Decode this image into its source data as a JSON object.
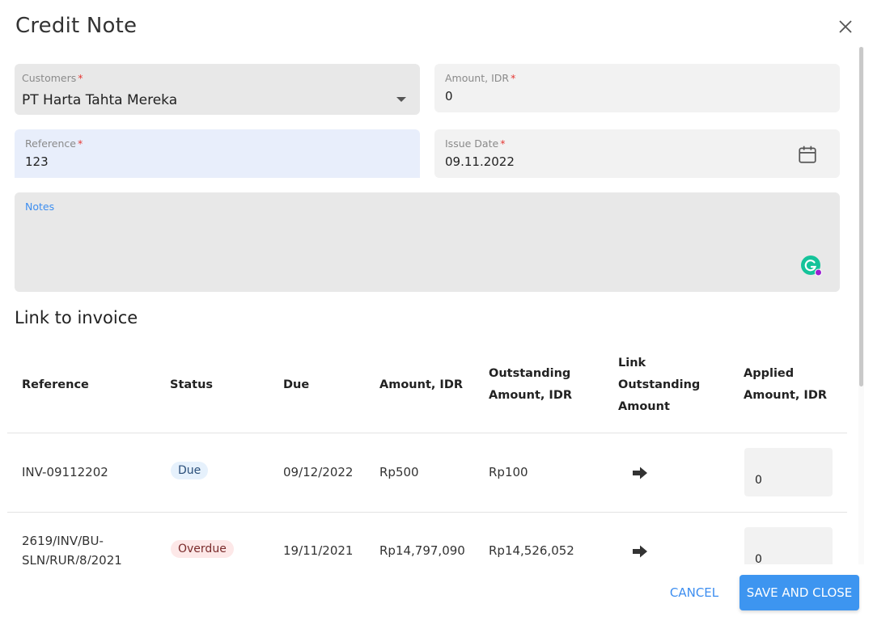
{
  "dialog": {
    "title": "Credit Note"
  },
  "form": {
    "customers": {
      "label": "Customers",
      "required_mark": "*",
      "value": "PT Harta Tahta Mereka"
    },
    "amount": {
      "label": "Amount, IDR",
      "required_mark": "*",
      "value": "0"
    },
    "reference": {
      "label": "Reference",
      "required_mark": "*",
      "value": "123"
    },
    "issue_date": {
      "label": "Issue Date",
      "required_mark": "*",
      "value": "09.11.2022"
    },
    "notes": {
      "label": "Notes",
      "value": ""
    }
  },
  "link_section": {
    "title": "Link to invoice",
    "columns": {
      "reference": "Reference",
      "status": "Status",
      "due": "Due",
      "amount": "Amount, IDR",
      "outstanding_1": "Outstanding",
      "outstanding_2": "Amount, IDR",
      "link_1": "Link",
      "link_2": "Outstanding",
      "link_3": "Amount",
      "applied_1": "Applied",
      "applied_2": "Amount, IDR"
    },
    "rows": [
      {
        "reference": "INV-09112202",
        "status": "Due",
        "due": "09/12/2022",
        "amount": "Rp500",
        "outstanding": "Rp100",
        "applied": "0"
      },
      {
        "reference_1": "2619/INV/BU-",
        "reference_2": "SLN/RUR/8/2021",
        "status": "Overdue",
        "due": "19/11/2021",
        "amount": "Rp14,797,090",
        "outstanding": "Rp14,526,052",
        "applied": "0"
      }
    ]
  },
  "actions": {
    "cancel": "CANCEL",
    "save": "SAVE AND CLOSE"
  },
  "icons": {
    "close": "close-icon",
    "dropdown": "chevron-down-icon",
    "calendar": "calendar-icon",
    "grammarly": "grammarly-icon",
    "link": "arrow-right-icon"
  },
  "colors": {
    "accent": "#3d95f0",
    "required": "#e53935",
    "due_badge_bg": "#e6f1fc",
    "overdue_badge_bg": "#fde8e8",
    "field_bg": "#f2f2f2",
    "active_field_bg": "#e8eefb"
  }
}
